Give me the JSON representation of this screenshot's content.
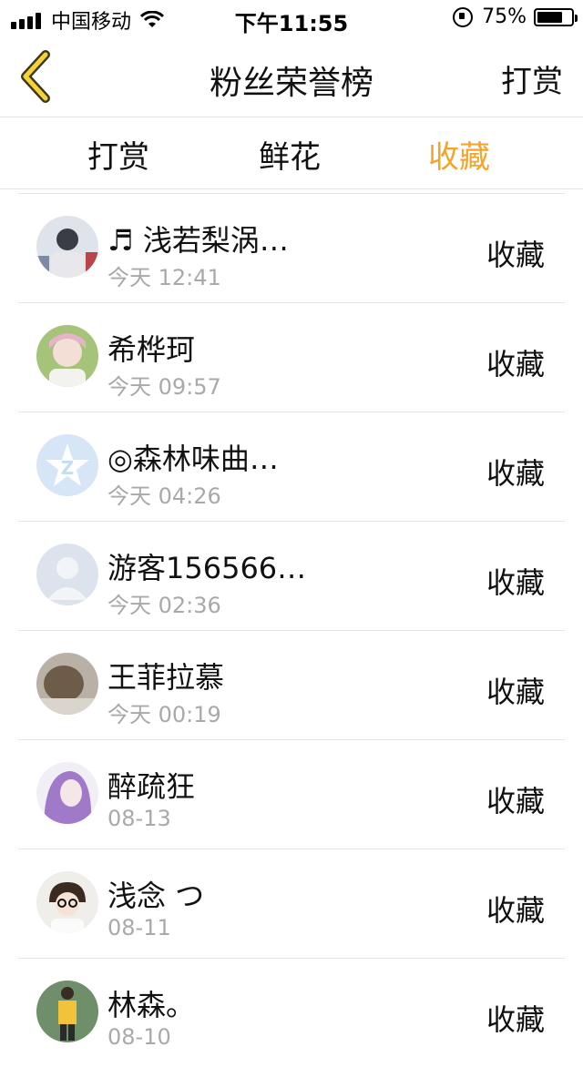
{
  "status_bar": {
    "carrier": "中国移动",
    "time": "下午11:55",
    "battery": "75%",
    "battery_level": 0.75
  },
  "nav": {
    "title": "粉丝荣誉榜",
    "right_label": "打赏"
  },
  "colors": {
    "accent": "#f2a52a",
    "secondary_text": "#a9a9a9",
    "divider": "#e5e5e5"
  },
  "tabs": [
    {
      "label": "打赏",
      "active": false
    },
    {
      "label": "鲜花",
      "active": false
    },
    {
      "label": "收藏",
      "active": true
    }
  ],
  "list": [
    {
      "name": "♬ 浅若梨涡…",
      "time": "今天 12:41",
      "action": "收藏",
      "avatar": "photo-avatar"
    },
    {
      "name": "希桦珂",
      "time": "今天 09:57",
      "action": "收藏",
      "avatar": "photo-avatar"
    },
    {
      "name": "◎森林味曲…",
      "time": "今天 04:26",
      "action": "收藏",
      "avatar": "qzone-default-avatar"
    },
    {
      "name": "游客156566…",
      "time": "今天 02:36",
      "action": "收藏",
      "avatar": "default-person-avatar"
    },
    {
      "name": "王菲拉慕",
      "time": "今天 00:19",
      "action": "收藏",
      "avatar": "photo-avatar"
    },
    {
      "name": "醉疏狂",
      "time": "08-13",
      "action": "收藏",
      "avatar": "photo-avatar"
    },
    {
      "name": "浅念 つ",
      "time": "08-11",
      "action": "收藏",
      "avatar": "photo-avatar"
    },
    {
      "name": "林森。",
      "time": "08-10",
      "action": "收藏",
      "avatar": "photo-avatar"
    }
  ]
}
